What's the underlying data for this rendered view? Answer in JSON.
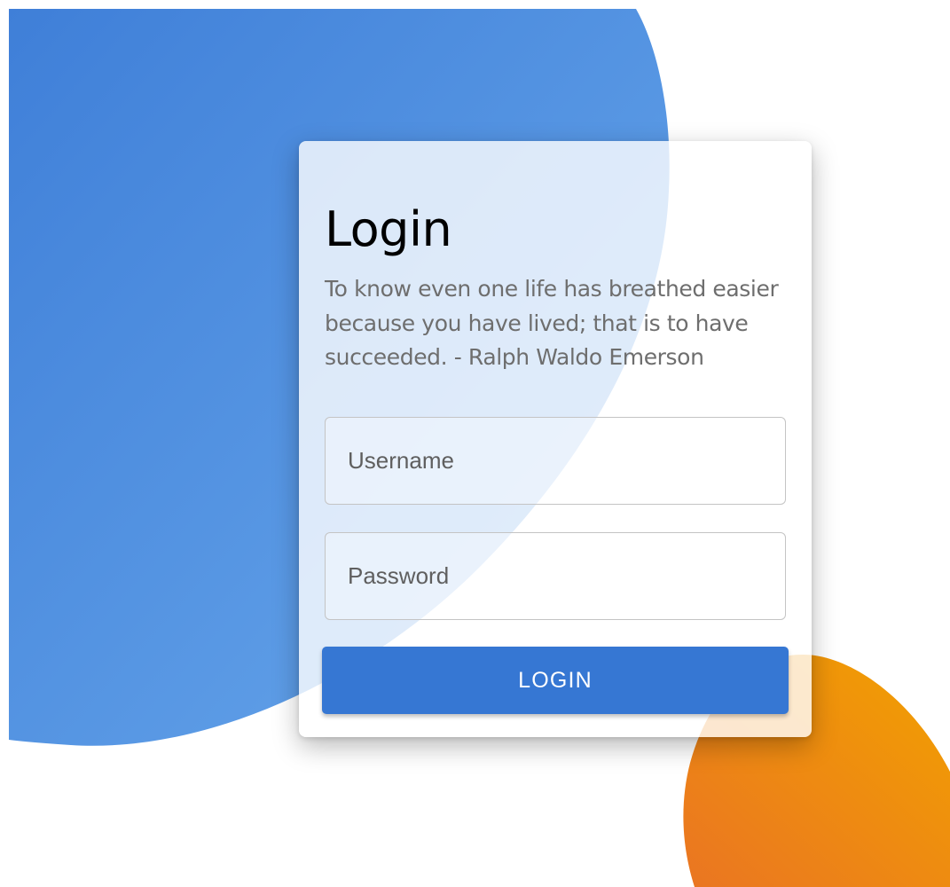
{
  "login": {
    "title": "Login",
    "quote": "To know even one life has breathed easier because you have lived; that is to have succeeded. - Ralph Waldo Emerson",
    "username": {
      "placeholder": "Username",
      "value": ""
    },
    "password": {
      "placeholder": "Password",
      "value": ""
    },
    "button_label": "LOGIN"
  },
  "colors": {
    "primary": "#3677d3",
    "blob_blue_start": "#3f7fd8",
    "blob_blue_end": "#6aa9ec",
    "blob_orange_start": "#f2a100",
    "blob_orange_end": "#ea7522"
  }
}
